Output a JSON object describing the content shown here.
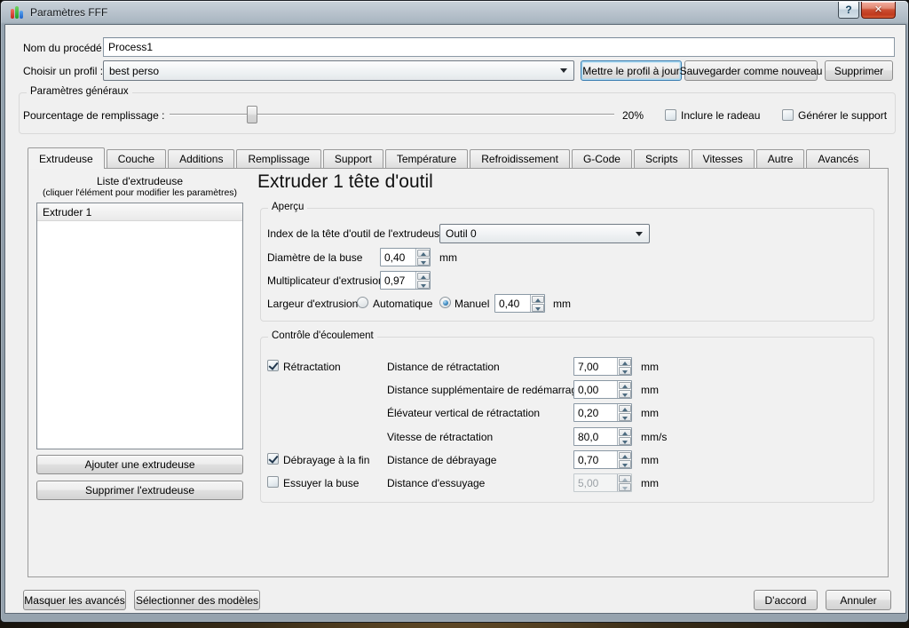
{
  "window": {
    "title": "Paramètres FFF",
    "help_glyph": "?",
    "close_glyph": "✕"
  },
  "header": {
    "process_name_label": "Nom du procédé :",
    "process_name_value": "Process1",
    "profile_label": "Choisir un profil :",
    "profile_value": "best perso",
    "update_profile_button": "Mettre le profil à jour",
    "save_as_new_button": "Sauvegarder comme nouveau",
    "delete_button": "Supprimer"
  },
  "general": {
    "group_title": "Paramètres généraux",
    "infill_label": "Pourcentage de remplissage :",
    "infill_value": "20%",
    "include_raft_label": "Inclure le radeau",
    "generate_support_label": "Générer le support"
  },
  "tabs": {
    "active": "Extrudeuse",
    "items": [
      "Extrudeuse",
      "Couche",
      "Additions",
      "Remplissage",
      "Support",
      "Température",
      "Refroidissement",
      "G-Code",
      "Scripts",
      "Vitesses",
      "Autre",
      "Avancés"
    ]
  },
  "extruder": {
    "list_title": "Liste d'extrudeuse",
    "list_subtitle": "(cliquer l'élément pour modifier les paramètres)",
    "list_items": [
      "Extruder 1"
    ],
    "add_extruder_button": "Ajouter une extrudeuse",
    "remove_extruder_button": "Supprimer l'extrudeuse",
    "heading": "Extruder 1 tête d'outil",
    "overview": {
      "group_title": "Aperçu",
      "toolhead_index_label": "Index de la tête d'outil de l'extrudeuse",
      "toolhead_index_value": "Outil 0",
      "nozzle_diameter_label": "Diamètre de la buse",
      "nozzle_diameter_value": "0,40",
      "nozzle_diameter_unit": "mm",
      "extrusion_multiplier_label": "Multiplicateur d'extrusion",
      "extrusion_multiplier_value": "0,97",
      "extrusion_width_label": "Largeur d'extrusion",
      "auto_option": "Automatique",
      "manual_option": "Manuel",
      "extrusion_width_value": "0,40",
      "extrusion_width_unit": "mm"
    },
    "ooze": {
      "group_title": "Contrôle d'écoulement",
      "rows": [
        {
          "checkbox": "Rétractation",
          "checked": true,
          "label": "Distance de rétractation",
          "value": "7,00",
          "unit": "mm"
        },
        {
          "label": "Distance supplémentaire de redémarrage",
          "value": "0,00",
          "unit": "mm"
        },
        {
          "label": "Élévateur vertical de rétractation",
          "value": "0,20",
          "unit": "mm"
        },
        {
          "label": "Vitesse de rétractation",
          "value": "80,0",
          "unit": "mm/s"
        },
        {
          "checkbox": "Débrayage à la fin",
          "checked": true,
          "label": "Distance de débrayage",
          "value": "0,70",
          "unit": "mm"
        },
        {
          "checkbox": "Essuyer la buse",
          "checked": false,
          "label": "Distance d'essuyage",
          "value": "5,00",
          "unit": "mm",
          "disabled": true
        }
      ]
    }
  },
  "footer": {
    "hide_advanced_button": "Masquer les avancés",
    "select_models_button": "Sélectionner des modèles",
    "ok_button": "D'accord",
    "cancel_button": "Annuler"
  },
  "colors": {
    "focus_accent": "#3c7fb1",
    "close_red": "#c03a1e",
    "client_bg": "#f0f0f0"
  }
}
